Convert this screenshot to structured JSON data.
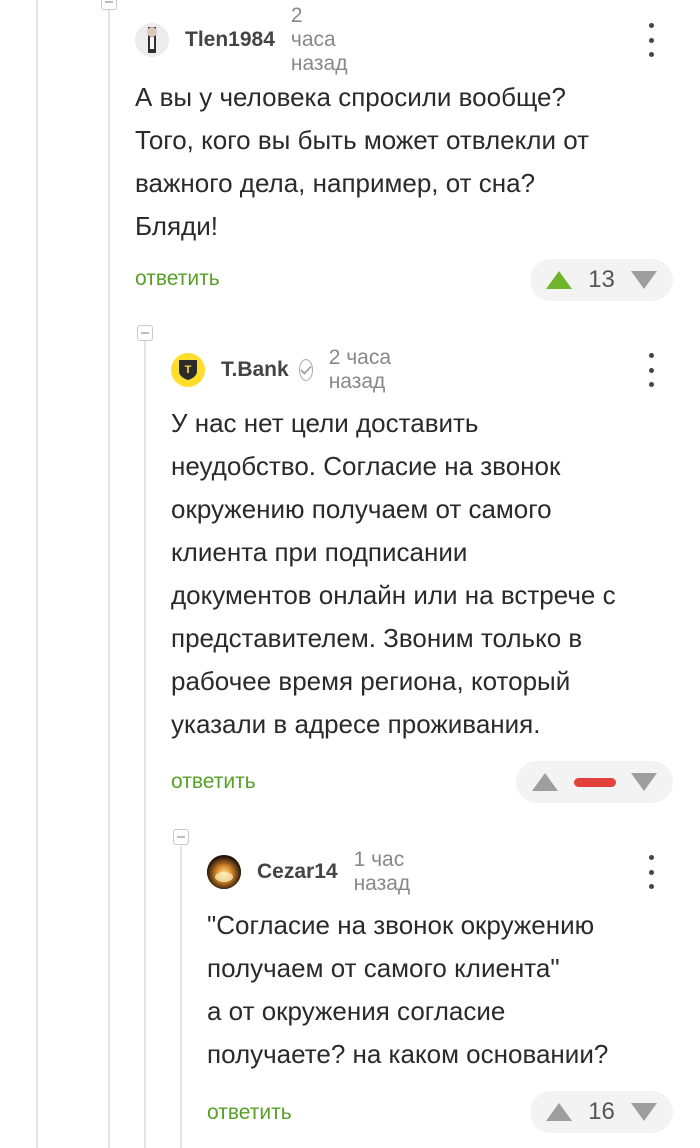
{
  "colors": {
    "accent": "#57a028",
    "upvote_active": "#6fb52c",
    "negative_rating": "#e3423c"
  },
  "comments": [
    {
      "username": "Tlen1984",
      "time": "2 часа назад",
      "text": [
        "А вы у человека спросили вообще?",
        "Того, кого вы быть может отвлекли от",
        "важного дела, например, от сна?",
        "Бляди!"
      ],
      "reply_label": "ответить",
      "score": "13",
      "avatar_icon": "user-avatar-icon"
    },
    {
      "username": "T.Bank",
      "time": "2 часа назад",
      "avatar_letter": "T",
      "text": [
        "У нас нет цели доставить",
        "неудобство. Согласие на звонок",
        "окружению получаем от самого",
        "клиента при подписании",
        "документов онлайн или на встрече с",
        "представителем. Звоним только в",
        "рабочее время региона, который",
        "указали в адресе проживания."
      ],
      "reply_label": "ответить",
      "score_indicator": "negative"
    },
    {
      "username": "Cezar14",
      "time": "1 час назад",
      "text": [
        "\"Согласие на звонок окружению",
        "получаем от самого клиента\"",
        "а от окружения согласие",
        "получаете? на каком основании?"
      ],
      "reply_label": "ответить",
      "score": "16"
    }
  ]
}
